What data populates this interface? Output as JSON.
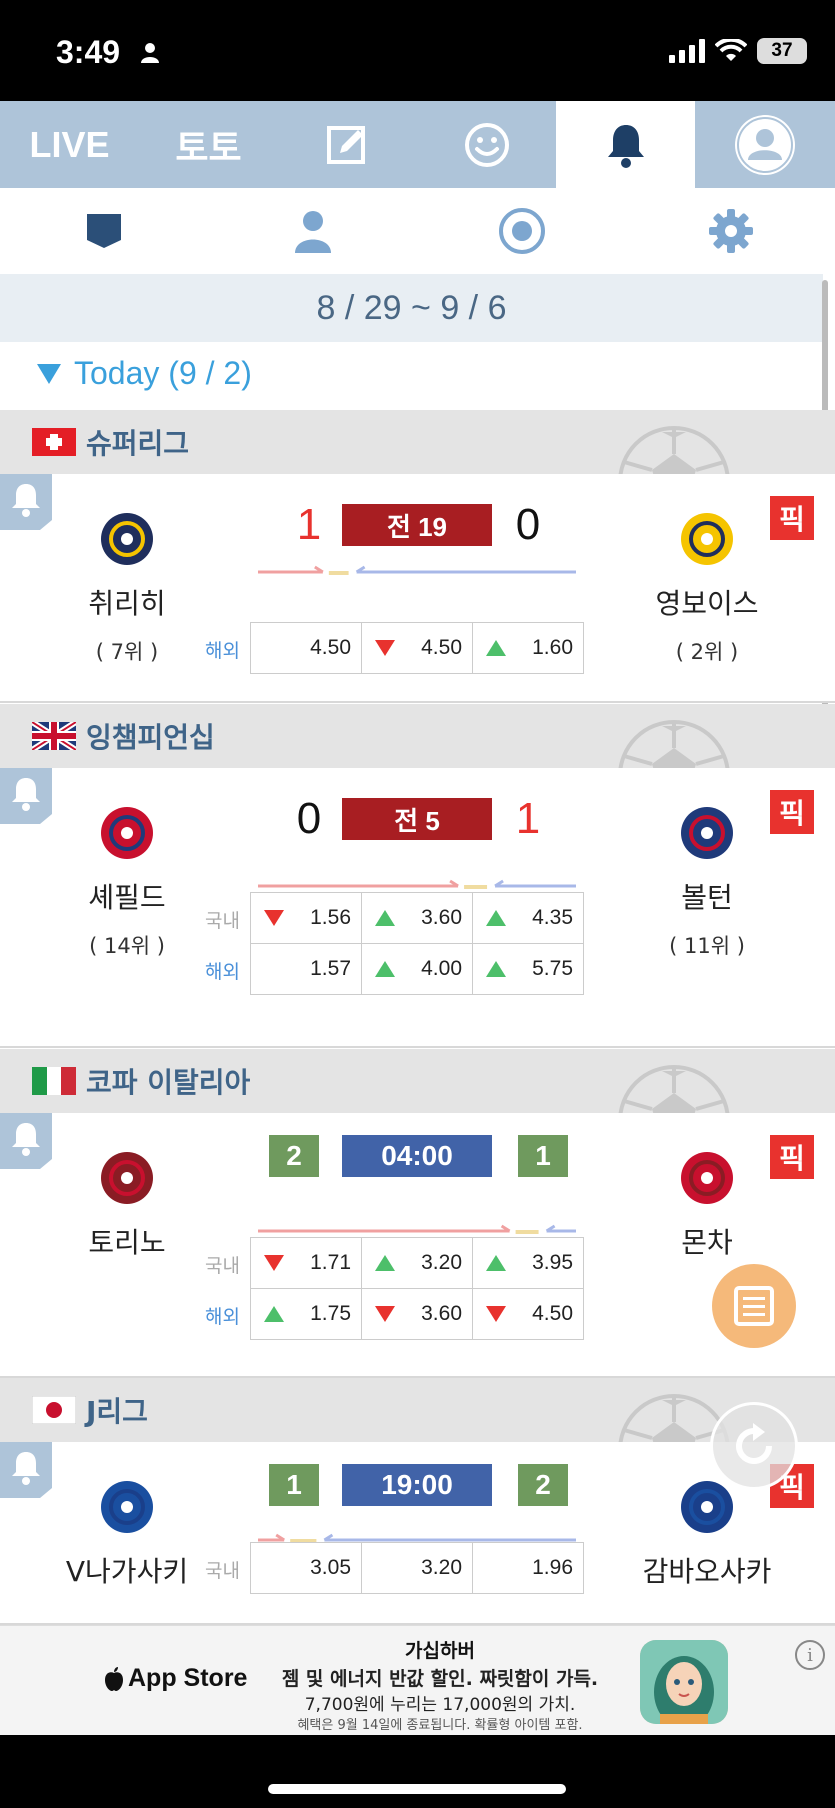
{
  "status_bar": {
    "time": "3:49",
    "battery": "37"
  },
  "top_nav": {
    "tabs": [
      {
        "label": "LIVE",
        "icon": null
      },
      {
        "label": "토토",
        "icon": null
      },
      {
        "label": "",
        "icon": "edit-icon"
      },
      {
        "label": "",
        "icon": "smiley-icon"
      },
      {
        "label": "",
        "icon": "bell-icon",
        "active": true
      },
      {
        "label": "",
        "icon": "profile-icon"
      }
    ]
  },
  "sub_nav": {
    "icons": [
      "shield-icon",
      "person-icon",
      "target-icon",
      "gear-icon"
    ]
  },
  "date_range": "8 / 29 ~ 9 / 6",
  "today_label": "Today (9 / 2)",
  "pick_label": "픽",
  "leagues": [
    {
      "name": "슈퍼리그",
      "flag": "switzerland",
      "match": {
        "home": {
          "name": "취리히",
          "rank": "( 7위 )"
        },
        "away": {
          "name": "영보이스",
          "rank": "( 2위 )"
        },
        "home_score": "1",
        "away_score": "0",
        "status": "전 19",
        "status_type": "half",
        "odds": [
          {
            "label": "해외",
            "type": "ovs",
            "cells": [
              {
                "arrow": "",
                "value": "4.50"
              },
              {
                "arrow": "down",
                "value": "4.50"
              },
              {
                "arrow": "up",
                "value": "1.60"
              }
            ]
          }
        ],
        "trend": [
          0.22,
          0.08,
          0.7
        ]
      }
    },
    {
      "name": "잉챔피언십",
      "flag": "uk",
      "match": {
        "home": {
          "name": "셰필드",
          "rank": "( 14위 )"
        },
        "away": {
          "name": "볼턴",
          "rank": "( 11위 )"
        },
        "home_score": "0",
        "away_score": "1",
        "status": "전 5",
        "status_type": "half",
        "odds": [
          {
            "label": "국내",
            "type": "dom",
            "cells": [
              {
                "arrow": "down",
                "value": "1.56"
              },
              {
                "arrow": "up",
                "value": "3.60"
              },
              {
                "arrow": "up",
                "value": "4.35"
              }
            ]
          },
          {
            "label": "해외",
            "type": "ovs",
            "cells": [
              {
                "arrow": "",
                "value": "1.57"
              },
              {
                "arrow": "up",
                "value": "4.00"
              },
              {
                "arrow": "up",
                "value": "5.75"
              }
            ]
          }
        ],
        "trend": [
          0.64,
          0.09,
          0.27
        ]
      }
    },
    {
      "name": "코파 이탈리아",
      "flag": "italy",
      "match": {
        "home": {
          "name": "토리노",
          "rank": ""
        },
        "away": {
          "name": "몬차",
          "rank": ""
        },
        "home_score": "2",
        "away_score": "1",
        "status": "04:00",
        "status_type": "time",
        "odds": [
          {
            "label": "국내",
            "type": "dom",
            "cells": [
              {
                "arrow": "down",
                "value": "1.71"
              },
              {
                "arrow": "up",
                "value": "3.20"
              },
              {
                "arrow": "up",
                "value": "3.95"
              }
            ]
          },
          {
            "label": "해외",
            "type": "ovs",
            "cells": [
              {
                "arrow": "up",
                "value": "1.75"
              },
              {
                "arrow": "down",
                "value": "3.60"
              },
              {
                "arrow": "down",
                "value": "4.50"
              }
            ]
          }
        ],
        "trend": [
          0.8,
          0.09,
          0.11
        ]
      }
    },
    {
      "name": "J리그",
      "flag": "japan",
      "match": {
        "home": {
          "name": "V나가사키",
          "rank": ""
        },
        "away": {
          "name": "감바오사카",
          "rank": ""
        },
        "home_score": "1",
        "away_score": "2",
        "status": "19:00",
        "status_type": "time",
        "odds": [
          {
            "label": "국내",
            "type": "dom",
            "cells": [
              {
                "arrow": "",
                "value": "3.05"
              },
              {
                "arrow": "",
                "value": "3.20"
              },
              {
                "arrow": "",
                "value": "1.96"
              }
            ]
          }
        ],
        "trend": [
          0.1,
          0.1,
          0.8
        ]
      }
    }
  ],
  "ad": {
    "store": "App Store",
    "title": "가십하버",
    "line1": "젬 및 에너지 반값 할인. 짜릿함이 가득.",
    "line2": "7,700원에 누리는 17,000원의 가치.",
    "line3": "혜택은 9월 14일에 종료됩니다. 확률형 아이템 포함.",
    "info": "i"
  },
  "colors": {
    "nav_bg": "#aec4d9",
    "accent_red": "#e8322e",
    "half_red": "#a81e22",
    "time_blue": "#4163a8",
    "score_green": "#6f9a5e"
  }
}
